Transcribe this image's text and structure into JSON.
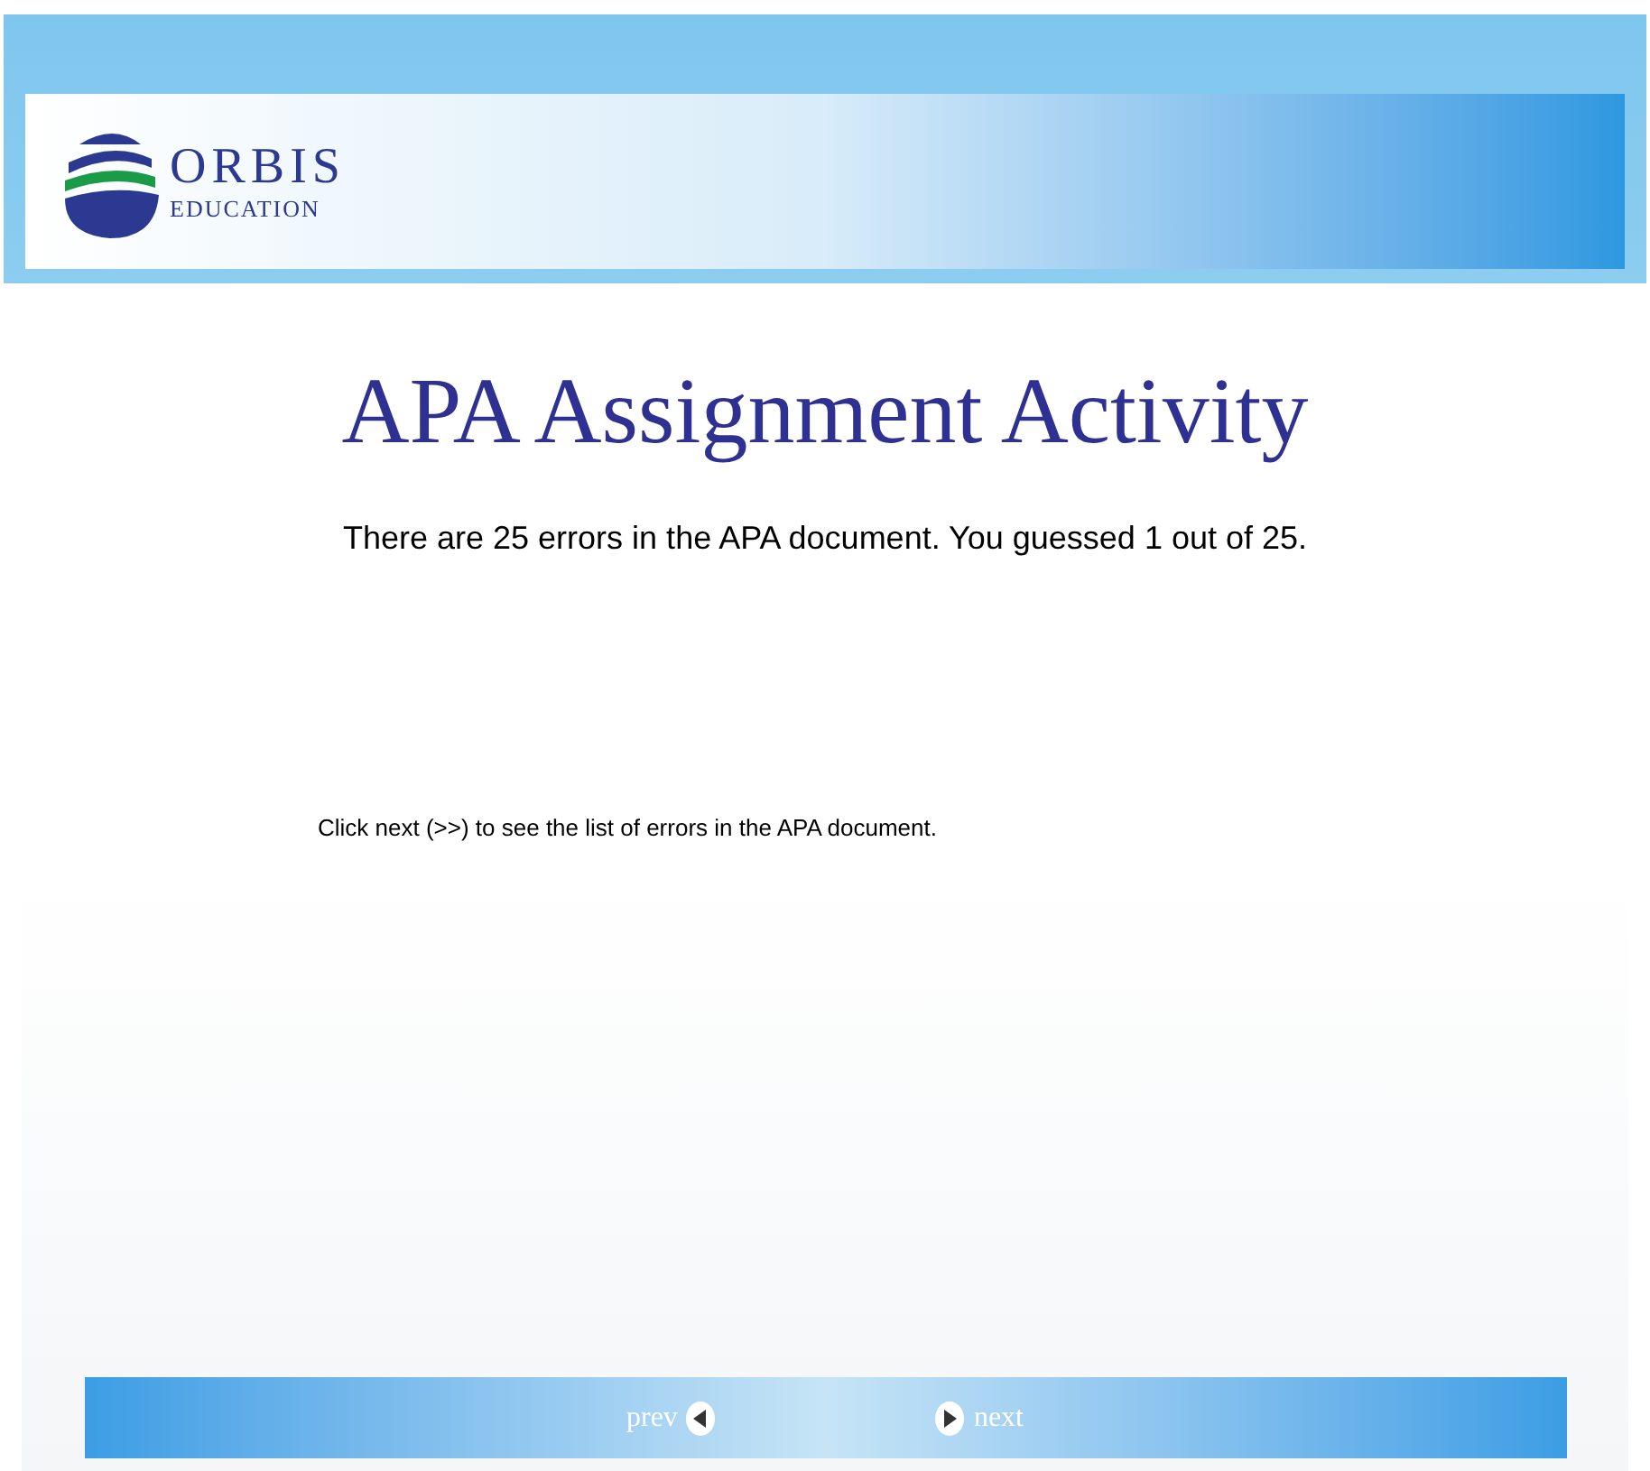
{
  "logo": {
    "name": "ORBIS",
    "tagline": "EDUCATION"
  },
  "title": "APA Assignment Activity",
  "result": "There are 25 errors in the APA document. You guessed 1 out of 25.",
  "instruction": "Click next (>>) to see the list of errors in the APA document.",
  "nav": {
    "prev": "prev",
    "next": "next"
  }
}
